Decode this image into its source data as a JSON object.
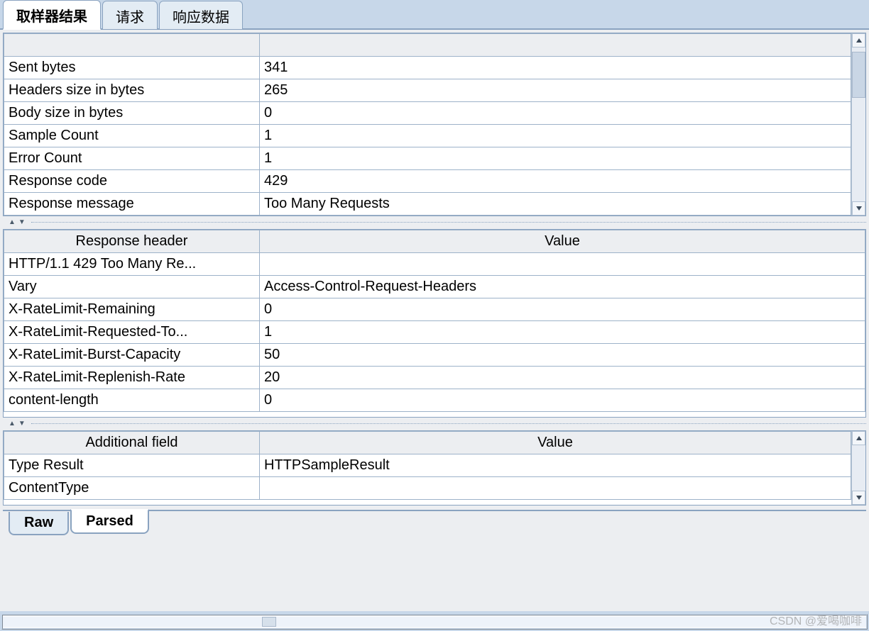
{
  "top_tabs": {
    "sampler": "取样器结果",
    "request": "请求",
    "response": "响应数据"
  },
  "bottom_tabs": {
    "raw": "Raw",
    "parsed": "Parsed"
  },
  "table1": {
    "rows": [
      {
        "k": "",
        "v": ""
      },
      {
        "k": "Sent bytes",
        "v": "341"
      },
      {
        "k": "Headers size in bytes",
        "v": "265"
      },
      {
        "k": "Body size in bytes",
        "v": "0"
      },
      {
        "k": "Sample Count",
        "v": "1"
      },
      {
        "k": "Error Count",
        "v": "1"
      },
      {
        "k": "Response code",
        "v": "429"
      },
      {
        "k": "Response message",
        "v": "Too Many Requests"
      }
    ]
  },
  "table2": {
    "header": {
      "k": "Response header",
      "v": "Value"
    },
    "rows": [
      {
        "k": "HTTP/1.1 429 Too Many Re...",
        "v": ""
      },
      {
        "k": "Vary",
        "v": "Access-Control-Request-Headers"
      },
      {
        "k": "X-RateLimit-Remaining",
        "v": "0"
      },
      {
        "k": "X-RateLimit-Requested-To...",
        "v": "1"
      },
      {
        "k": "X-RateLimit-Burst-Capacity",
        "v": "50"
      },
      {
        "k": "X-RateLimit-Replenish-Rate",
        "v": "20"
      },
      {
        "k": "content-length",
        "v": "0"
      }
    ]
  },
  "table3": {
    "header": {
      "k": "Additional field",
      "v": "Value"
    },
    "rows": [
      {
        "k": "Type Result",
        "v": "HTTPSampleResult"
      },
      {
        "k": "ContentType",
        "v": ""
      }
    ]
  },
  "watermark": "CSDN @爱喝咖啡"
}
